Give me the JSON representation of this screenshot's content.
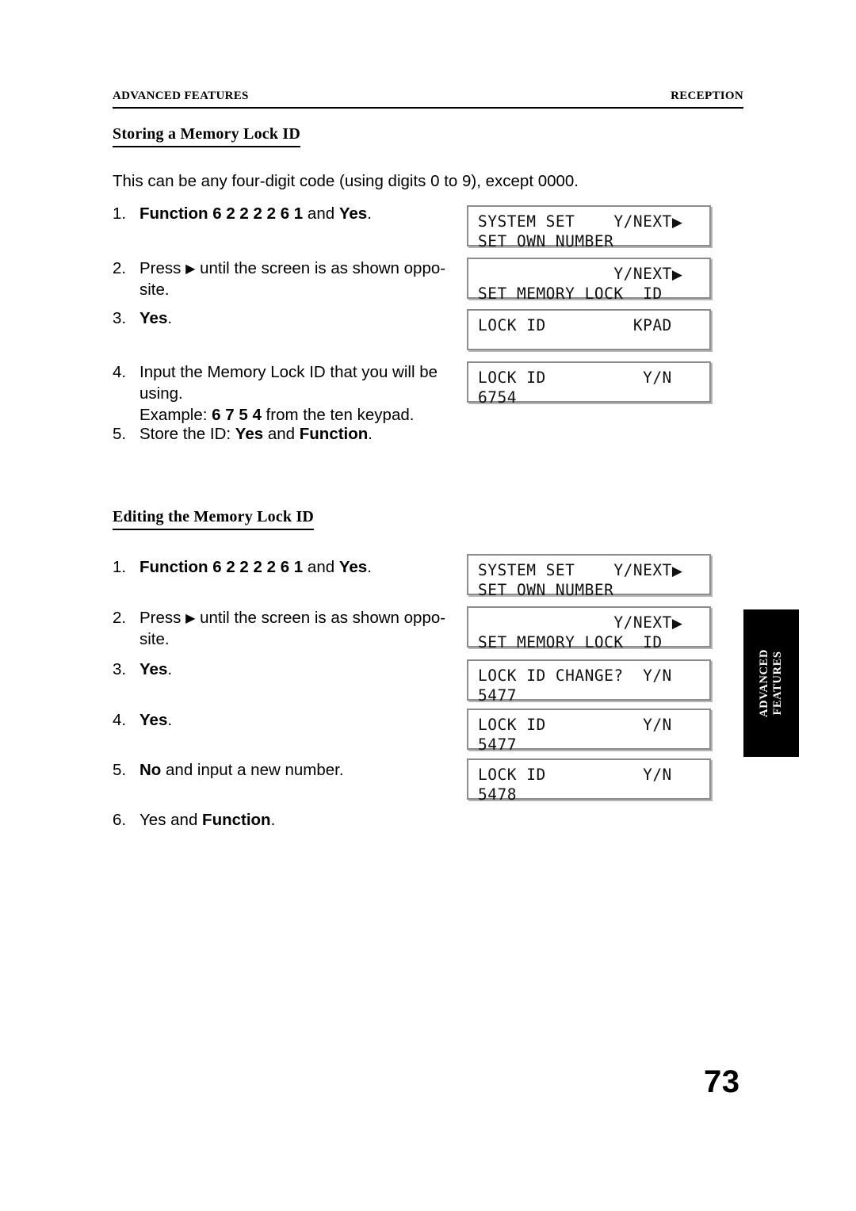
{
  "header": {
    "left": "ADVANCED FEATURES",
    "right": "RECEPTION"
  },
  "sections": [
    {
      "heading": "Storing a Memory Lock ID",
      "intro": "This can be any four-digit code (using digits 0 to 9), except 0000.",
      "steps": [
        {
          "num": "1.",
          "text_parts": [
            {
              "t": "Function 6 2 2 2 2 6 1",
              "bold": true
            },
            {
              "t": " and ",
              "bold": false
            },
            {
              "t": "Yes",
              "bold": true
            },
            {
              "t": ".",
              "bold": false
            }
          ]
        },
        {
          "num": "2.",
          "text_parts": [
            {
              "t": "Press ",
              "bold": false
            },
            {
              "t": "▶",
              "bold": false,
              "arrow": true
            },
            {
              "t": " until the screen is as shown oppo-site.",
              "bold": false
            }
          ]
        },
        {
          "num": "3.",
          "text_parts": [
            {
              "t": "Yes",
              "bold": true
            },
            {
              "t": ".",
              "bold": false
            }
          ]
        },
        {
          "num": "4.",
          "text_parts": [
            {
              "t": "Input the Memory Lock ID that you will be using.",
              "bold": false
            },
            {
              "t": "\nExample: ",
              "bold": false
            },
            {
              "t": "6 7 5 4",
              "bold": true
            },
            {
              "t": " from the ten keypad.",
              "bold": false
            }
          ]
        },
        {
          "num": "5.",
          "text_parts": [
            {
              "t": "Store the ID: ",
              "bold": false
            },
            {
              "t": "Yes",
              "bold": true
            },
            {
              "t": " and ",
              "bold": false
            },
            {
              "t": "Function",
              "bold": true
            },
            {
              "t": ".",
              "bold": false
            }
          ]
        }
      ],
      "screens": [
        {
          "line1": "SYSTEM SET    Y/NEXT",
          "arrow1": true,
          "line2": "SET OWN NUMBER",
          "arrow2": false
        },
        {
          "line1": "              Y/NEXT",
          "arrow1": true,
          "line2": "SET MEMORY LOCK  ID",
          "arrow2": false
        },
        {
          "line1": "LOCK ID         KPAD",
          "arrow1": false,
          "line2": "",
          "arrow2": false
        },
        {
          "line1": "LOCK ID          Y/N",
          "arrow1": false,
          "line2": "6754",
          "arrow2": false
        }
      ]
    },
    {
      "heading": "Editing the Memory Lock ID",
      "steps": [
        {
          "num": "1.",
          "text_parts": [
            {
              "t": "Function 6 2 2 2 2 6 1",
              "bold": true
            },
            {
              "t": " and ",
              "bold": false
            },
            {
              "t": "Yes",
              "bold": true
            },
            {
              "t": ".",
              "bold": false
            }
          ]
        },
        {
          "num": "2.",
          "text_parts": [
            {
              "t": "Press ",
              "bold": false
            },
            {
              "t": "▶",
              "bold": false,
              "arrow": true
            },
            {
              "t": " until the screen is as shown oppo-site.",
              "bold": false
            }
          ]
        },
        {
          "num": "3.",
          "text_parts": [
            {
              "t": "Yes",
              "bold": true
            },
            {
              "t": ".",
              "bold": false
            }
          ]
        },
        {
          "num": "4.",
          "text_parts": [
            {
              "t": "Yes",
              "bold": true
            },
            {
              "t": ".",
              "bold": false
            }
          ]
        },
        {
          "num": "5.",
          "text_parts": [
            {
              "t": "No",
              "bold": true
            },
            {
              "t": " and input a new number.",
              "bold": false
            }
          ]
        },
        {
          "num": "6.",
          "text_parts": [
            {
              "t": "Yes and ",
              "bold": false
            },
            {
              "t": "Function",
              "bold": true
            },
            {
              "t": ".",
              "bold": false
            }
          ]
        }
      ],
      "screens": [
        {
          "line1": "SYSTEM SET    Y/NEXT",
          "arrow1": true,
          "line2": "SET OWN NUMBER",
          "arrow2": false
        },
        {
          "line1": "              Y/NEXT",
          "arrow1": true,
          "line2": "SET MEMORY LOCK  ID",
          "arrow2": false
        },
        {
          "line1": "LOCK ID CHANGE?  Y/N",
          "arrow1": false,
          "line2": "5477",
          "arrow2": false
        },
        {
          "line1": "LOCK ID          Y/N",
          "arrow1": false,
          "line2": "5477",
          "arrow2": false
        },
        {
          "line1": "LOCK ID          Y/N",
          "arrow1": false,
          "line2": "5478",
          "arrow2": false
        }
      ]
    }
  ],
  "side_tab": {
    "line1": "ADVANCED",
    "line2": "FEATURES"
  },
  "page_number": "73",
  "colors": {
    "text": "#000000",
    "lcd_border": "#8c8c8c",
    "lcd_shadow": "#b4b4b4",
    "tab_background": "#000000",
    "tab_text": "#ffffff"
  }
}
